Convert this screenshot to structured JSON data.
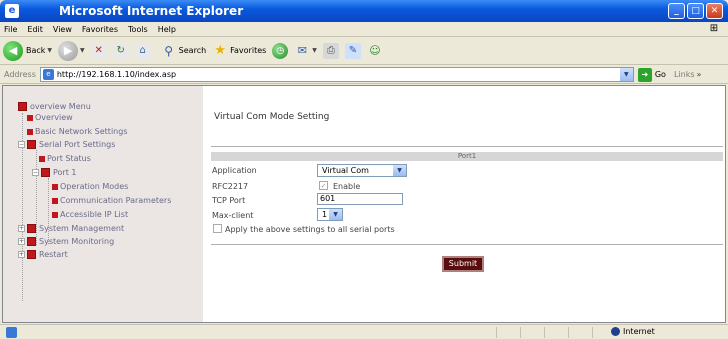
{
  "window": {
    "title": "Microsoft Internet Explorer"
  },
  "menubar": {
    "items": [
      "File",
      "Edit",
      "View",
      "Favorites",
      "Tools",
      "Help"
    ]
  },
  "toolbar": {
    "back_label": "Back",
    "search_label": "Search",
    "favorites_label": "Favorites"
  },
  "addressbar": {
    "label": "Address",
    "url": "http://192.168.1.10/index.asp",
    "go_label": "Go",
    "links_label": "Links"
  },
  "nav": {
    "root": "overview Menu",
    "overview": "Overview",
    "basic_network": "Basic Network Settings",
    "serial_port": "Serial Port Settings",
    "port_status": "Port Status",
    "port1": "Port 1",
    "operation_modes": "Operation Modes",
    "communication_parameters": "Communication Parameters",
    "accessible_ip": "Accessible IP List",
    "system_management": "System Management",
    "system_monitoring": "System Monitoring",
    "restart": "Restart"
  },
  "form": {
    "title": "Virtual Com Mode Setting",
    "port_header": "Port1",
    "application_label": "Application",
    "application_value": "Virtual Com",
    "rfc_label": "RFC2217",
    "rfc_enable_label": "Enable",
    "tcp_port_label": "TCP Port",
    "tcp_port_value": "601",
    "max_client_label": "Max-client",
    "max_client_value": "1",
    "apply_all_label": "Apply the above settings to all serial ports",
    "submit_label": "Submit"
  },
  "statusbar": {
    "zone": "Internet"
  }
}
